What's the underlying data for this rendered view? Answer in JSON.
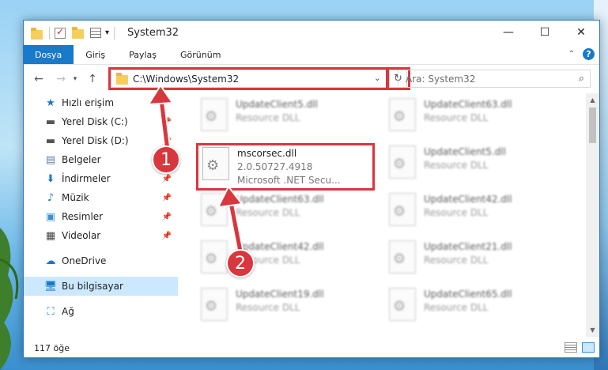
{
  "window": {
    "title": "System32",
    "buttons": {
      "minimize": "—",
      "maximize": "☐",
      "close": "✕"
    }
  },
  "ribbon": {
    "tabs": [
      {
        "label": "Dosya",
        "active": true
      },
      {
        "label": "Giriş"
      },
      {
        "label": "Paylaş"
      },
      {
        "label": "Görünüm"
      }
    ],
    "help": "?"
  },
  "nav": {
    "address": "C:\\Windows\\System32",
    "search_placeholder": "Ara: System32"
  },
  "sidebar": {
    "items": [
      {
        "label": "Hızlı erişim",
        "icon": "star-icon"
      },
      {
        "label": "Yerel Disk (C:)",
        "icon": "drive-icon",
        "pinned": true
      },
      {
        "label": "Yerel Disk (D:)",
        "icon": "drive-icon",
        "pinned": true
      },
      {
        "label": "Belgeler",
        "icon": "documents-icon",
        "pinned": true
      },
      {
        "label": "İndirmeler",
        "icon": "download-icon",
        "pinned": true
      },
      {
        "label": "Müzik",
        "icon": "music-icon",
        "pinned": true
      },
      {
        "label": "Resimler",
        "icon": "pictures-icon",
        "pinned": true
      },
      {
        "label": "Videolar",
        "icon": "videos-icon",
        "pinned": true
      },
      {
        "label": "OneDrive",
        "icon": "cloud-icon"
      },
      {
        "label": "Bu bilgisayar",
        "icon": "computer-icon",
        "selected": true
      },
      {
        "label": "Ağ",
        "icon": "network-icon"
      }
    ]
  },
  "files": [
    {
      "name": "UpdateClient5.dll",
      "desc": "Resource DLL",
      "blurred": true
    },
    {
      "name": "UpdateClient63.dll",
      "desc": "Resource DLL",
      "blurred": true
    },
    {
      "name": "mscorsec.dll",
      "version": "2.0.50727.4918",
      "desc": "Microsoft .NET Secu...",
      "blurred": false
    },
    {
      "name": "UpdateClient5.dll",
      "desc": "Resource DLL",
      "blurred": true
    },
    {
      "name": "UpdateClient63.dll",
      "desc": "Resource DLL",
      "blurred": true
    },
    {
      "name": "UpdateClient42.dll",
      "desc": "Resource DLL",
      "blurred": true
    },
    {
      "name": "UpdateClient42.dll",
      "desc": "Resource DLL",
      "blurred": true
    },
    {
      "name": "UpdateClient21.dll",
      "desc": "Resource DLL",
      "blurred": true
    },
    {
      "name": "UpdateClient19.dll",
      "desc": "Resource DLL",
      "blurred": true
    },
    {
      "name": "UpdateClient65.dll",
      "desc": "Resource DLL",
      "blurred": true
    }
  ],
  "status": {
    "count": "117 öğe"
  },
  "annotations": {
    "callout1": "1",
    "callout2": "2"
  },
  "colors": {
    "accent": "#1979ca",
    "highlight": "#d9363e",
    "selected": "#cce8ff"
  }
}
